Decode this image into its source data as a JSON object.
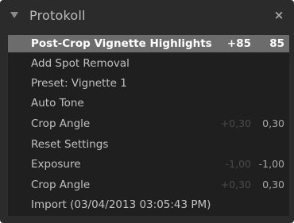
{
  "panel": {
    "title": "Protokoll",
    "close_label": "×"
  },
  "history": [
    {
      "label": "Post-Crop Vignette Highlights",
      "before": "+85",
      "after": "85",
      "selected": true
    },
    {
      "label": "Add Spot Removal",
      "before": "",
      "after": ""
    },
    {
      "label": "Preset: Vignette 1",
      "before": "",
      "after": ""
    },
    {
      "label": "Auto Tone",
      "before": "",
      "after": ""
    },
    {
      "label": "Crop Angle",
      "before": "+0,30",
      "after": "0,30"
    },
    {
      "label": "Reset Settings",
      "before": "",
      "after": ""
    },
    {
      "label": "Exposure",
      "before": "-1,00",
      "after": "-1,00"
    },
    {
      "label": "Crop Angle",
      "before": "+0,30",
      "after": "0,30"
    },
    {
      "label": "Import (03/04/2013 03:05:43 PM)",
      "before": "",
      "after": ""
    }
  ]
}
